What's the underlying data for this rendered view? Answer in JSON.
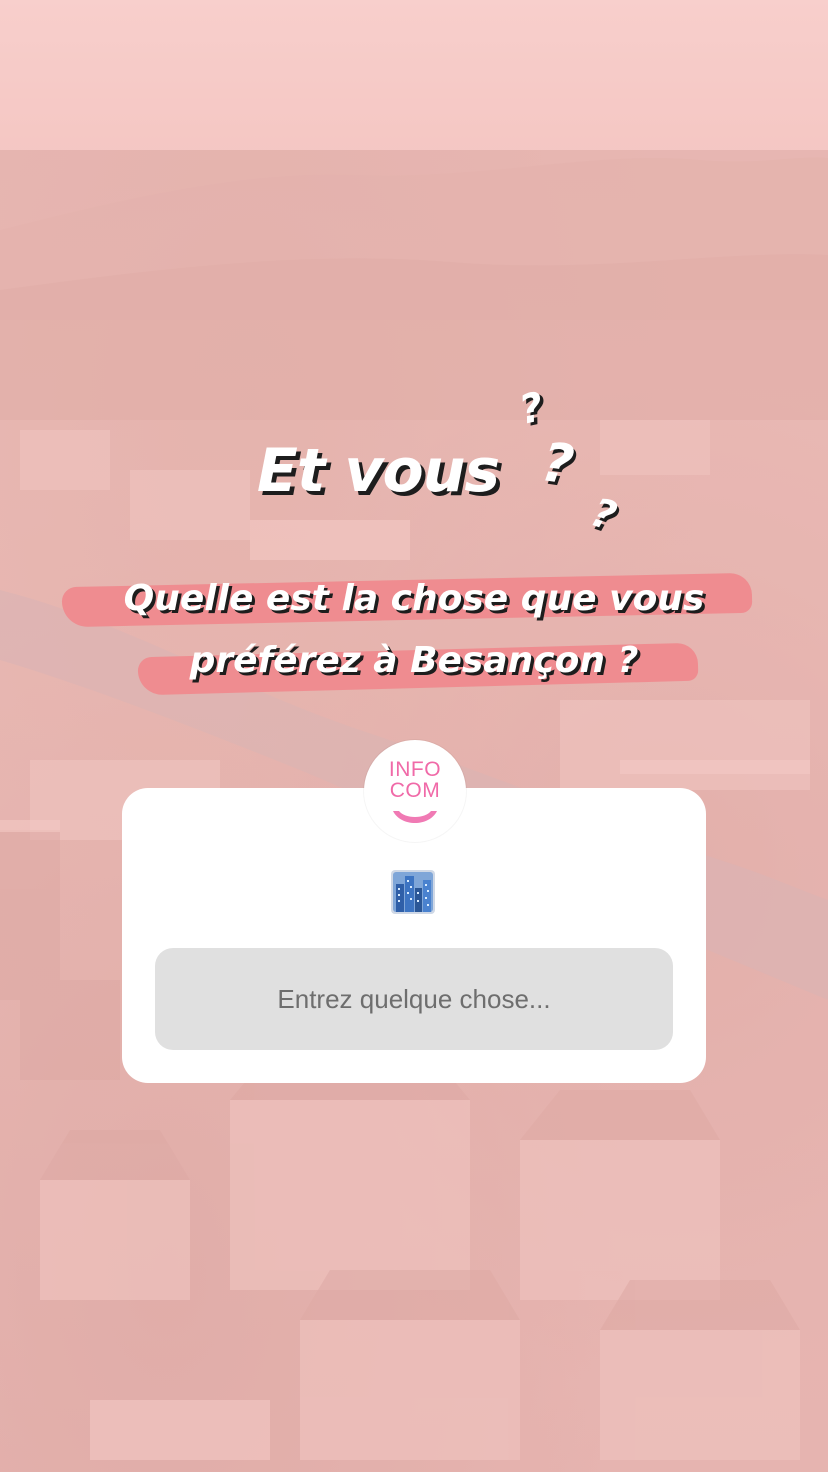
{
  "story": {
    "headline": "Et vous",
    "question_marks": [
      "?",
      "?",
      "?"
    ],
    "question_line_1": "Quelle est la chose que vous",
    "question_line_2": "préférez à Besançon ?"
  },
  "sticker": {
    "avatar_line_1": "INFO",
    "avatar_line_2": "COM",
    "emoji": "city-skyline-icon",
    "input_placeholder": "Entrez quelque chose..."
  },
  "colors": {
    "highlight": "#ef8a8e",
    "avatar_text": "#f06aa8",
    "input_background": "#e0e0e0"
  }
}
